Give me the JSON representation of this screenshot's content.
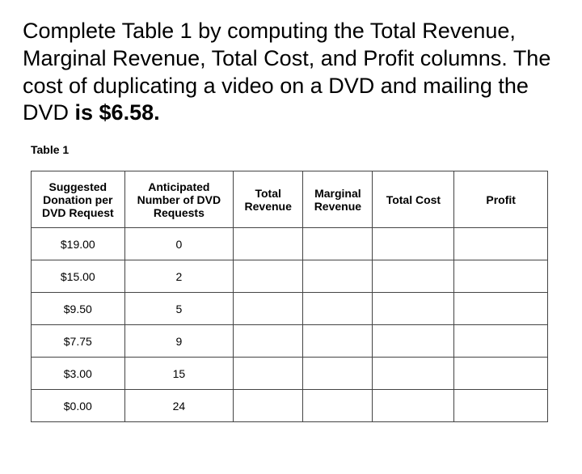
{
  "question": {
    "text_part1": "Complete Table 1 by computing the Total Revenue, Marginal Revenue, Total Cost, and Profit columns. The cost of duplicating a video on a DVD and mailing the DVD ",
    "text_bold": "is $6.58."
  },
  "table": {
    "caption": "Table 1",
    "headers": {
      "col1": "Suggested Donation per DVD Request",
      "col2": "Anticipated Number of DVD Requests",
      "col3": "Total Revenue",
      "col4": "Marginal Revenue",
      "col5": "Total Cost",
      "col6": "Profit"
    },
    "rows": [
      {
        "donation": "$19.00",
        "requests": "0",
        "total_revenue": "",
        "marginal_revenue": "",
        "total_cost": "",
        "profit": ""
      },
      {
        "donation": "$15.00",
        "requests": "2",
        "total_revenue": "",
        "marginal_revenue": "",
        "total_cost": "",
        "profit": ""
      },
      {
        "donation": "$9.50",
        "requests": "5",
        "total_revenue": "",
        "marginal_revenue": "",
        "total_cost": "",
        "profit": ""
      },
      {
        "donation": "$7.75",
        "requests": "9",
        "total_revenue": "",
        "marginal_revenue": "",
        "total_cost": "",
        "profit": ""
      },
      {
        "donation": "$3.00",
        "requests": "15",
        "total_revenue": "",
        "marginal_revenue": "",
        "total_cost": "",
        "profit": ""
      },
      {
        "donation": "$0.00",
        "requests": "24",
        "total_revenue": "",
        "marginal_revenue": "",
        "total_cost": "",
        "profit": ""
      }
    ]
  },
  "chart_data": {
    "type": "table",
    "title": "Table 1",
    "cost_per_dvd": 6.58,
    "columns": [
      "Suggested Donation per DVD Request",
      "Anticipated Number of DVD Requests",
      "Total Revenue",
      "Marginal Revenue",
      "Total Cost",
      "Profit"
    ],
    "rows": [
      {
        "donation": 19.0,
        "requests": 0
      },
      {
        "donation": 15.0,
        "requests": 2
      },
      {
        "donation": 9.5,
        "requests": 5
      },
      {
        "donation": 7.75,
        "requests": 9
      },
      {
        "donation": 3.0,
        "requests": 15
      },
      {
        "donation": 0.0,
        "requests": 24
      }
    ]
  }
}
